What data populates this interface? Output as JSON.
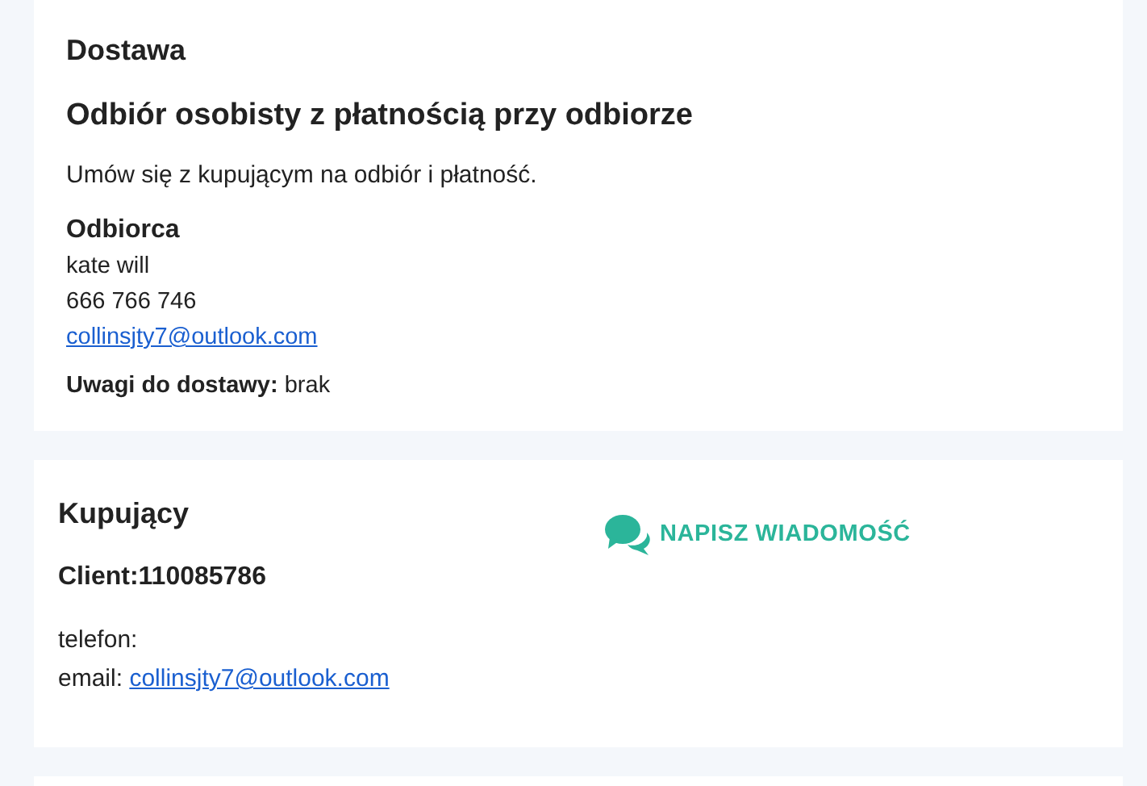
{
  "delivery": {
    "heading": "Dostawa",
    "method": "Odbiór osobisty z płatnością przy odbiorze",
    "instruction": "Umów się z kupującym na odbiór i płatność.",
    "recipient": {
      "label": "Odbiorca",
      "name": "kate will",
      "phone": "666 766 746",
      "email": "collinsjty7@outlook.com"
    },
    "notes": "**Uwagi do dostawy:** brak"
  },
  "buyer": {
    "heading": "Kupujący",
    "client": "Client:110085786",
    "phone_label": "telefon:",
    "email_label": "email:",
    "email": "collinsjty7@outlook.com",
    "message_button": "NAPISZ WIADOMOŚĆ"
  }
}
